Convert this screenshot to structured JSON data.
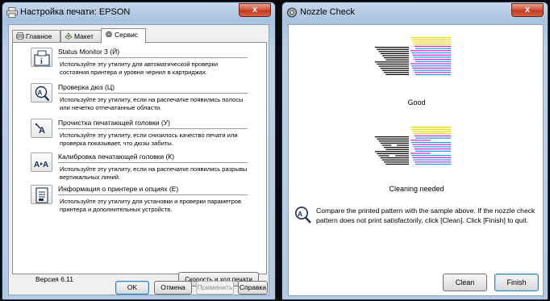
{
  "left_window": {
    "title": "Настройка печати: EPSON",
    "close_glyph": "x",
    "tabs": [
      {
        "label": "Главное",
        "icon": "printer-main-icon"
      },
      {
        "label": "Макет",
        "icon": "layout-icon"
      },
      {
        "label": "Сервис",
        "icon": "service-icon"
      }
    ],
    "active_tab": "Сервис",
    "utilities": [
      {
        "title": "Status Monitor 3 (Й)",
        "desc": "Используйте эту утилиту для автоматической проверки состояния принтера и уровня чернил в картриджах.",
        "icon": "status-monitor-icon"
      },
      {
        "title": "Проверка дюз (Ц)",
        "desc": "Используйте эту утилиту, если на распечатке появились полосы или нечетко отпечатанные области.",
        "icon": "nozzle-check-icon"
      },
      {
        "title": "Прочистка печатающей головки (У)",
        "desc": "Используйте эту утилиту, если снизилось качество печати или проверка показывает, что дюзы забиты.",
        "icon": "head-cleaning-icon"
      },
      {
        "title": "Калибровка печатающей головки (К)",
        "desc": "Используйте эту утилиту, если на распечатке появились разрывы вертикальных линий.",
        "icon": "head-alignment-icon"
      },
      {
        "title": "Информация о принтере и опциях (Е)",
        "desc": "Используйте эту утилиту для установки и проверки параметров принтера и дополнительных устройств.",
        "icon": "printer-info-icon"
      }
    ],
    "version": "Версия 6.11",
    "speed_button": "Скорость и ход печати",
    "buttons": {
      "ok": "OK",
      "cancel": "Отмена",
      "apply": "Применить",
      "help": "Справка"
    }
  },
  "right_window": {
    "title": "Nozzle Check",
    "close_glyph": "x",
    "good_label": "Good",
    "cleaning_label": "Cleaning needed",
    "instruction": "Compare the printed pattern with the sample above. If the nozzle check pattern does not print satisfactorily, click [Clean]. Click [Finish] to quit.",
    "clean_button": "Clean",
    "finish_button": "Finish"
  },
  "colors": {
    "pattern_black": "#000000",
    "pattern_cyan": "#00a0d8",
    "pattern_magenta": "#d81ed8",
    "pattern_yellow": "#e8d800"
  }
}
